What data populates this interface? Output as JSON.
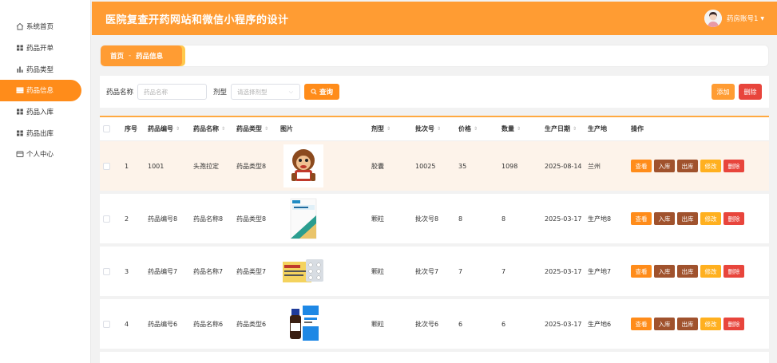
{
  "header": {
    "title": "医院复查开药网站和微信小程序的设计",
    "user": "药房账号1"
  },
  "sidebar": {
    "items": [
      {
        "label": "系统首页",
        "icon": "home-icon"
      },
      {
        "label": "药品开单",
        "icon": "grid-icon"
      },
      {
        "label": "药品类型",
        "icon": "bar-chart-icon"
      },
      {
        "label": "药品信息",
        "icon": "list-icon",
        "active": true
      },
      {
        "label": "药品入库",
        "icon": "grid-icon"
      },
      {
        "label": "药品出库",
        "icon": "grid-icon"
      },
      {
        "label": "个人中心",
        "icon": "card-icon"
      }
    ]
  },
  "breadcrumb": {
    "home": "首页",
    "sep": "-",
    "current": "药品信息"
  },
  "search": {
    "name_label": "药品名称",
    "name_placeholder": "药品名称",
    "type_label": "剂型",
    "type_placeholder": "请选择剂型",
    "search_btn": "查询",
    "add_btn": "添加",
    "delete_btn": "删除"
  },
  "table": {
    "headers": [
      "序号",
      "药品编号",
      "药品名称",
      "药品类型",
      "图片",
      "剂型",
      "批次号",
      "价格",
      "数量",
      "生产日期",
      "生产地",
      "操作"
    ],
    "rows": [
      {
        "no": "1",
        "code": "1001",
        "name": "头孢拉定",
        "type": "药品类型8",
        "form": "胶囊",
        "batch": "10025",
        "price": "35",
        "qty": "1098",
        "date": "2025-08-14",
        "origin": "兰州"
      },
      {
        "no": "2",
        "code": "药品编号8",
        "name": "药品名称8",
        "type": "药品类型8",
        "form": "颗粒",
        "batch": "批次号8",
        "price": "8",
        "qty": "8",
        "date": "2025-03-17",
        "origin": "生产地8"
      },
      {
        "no": "3",
        "code": "药品编号7",
        "name": "药品名称7",
        "type": "药品类型7",
        "form": "颗粒",
        "batch": "批次号7",
        "price": "7",
        "qty": "7",
        "date": "2025-03-17",
        "origin": "生产地7"
      },
      {
        "no": "4",
        "code": "药品编号6",
        "name": "药品名称6",
        "type": "药品类型6",
        "form": "颗粒",
        "batch": "批次号6",
        "price": "6",
        "qty": "6",
        "date": "2025-03-17",
        "origin": "生产地6"
      }
    ],
    "ops": {
      "view": "查看",
      "in": "入库",
      "out": "出库",
      "edit": "修改",
      "del": "删除"
    }
  },
  "colors": {
    "accent": "#ff9c33",
    "active": "#ff8c1a",
    "danger": "#e8453c",
    "brown": "#a0522d",
    "yellow": "#ffb01f"
  }
}
